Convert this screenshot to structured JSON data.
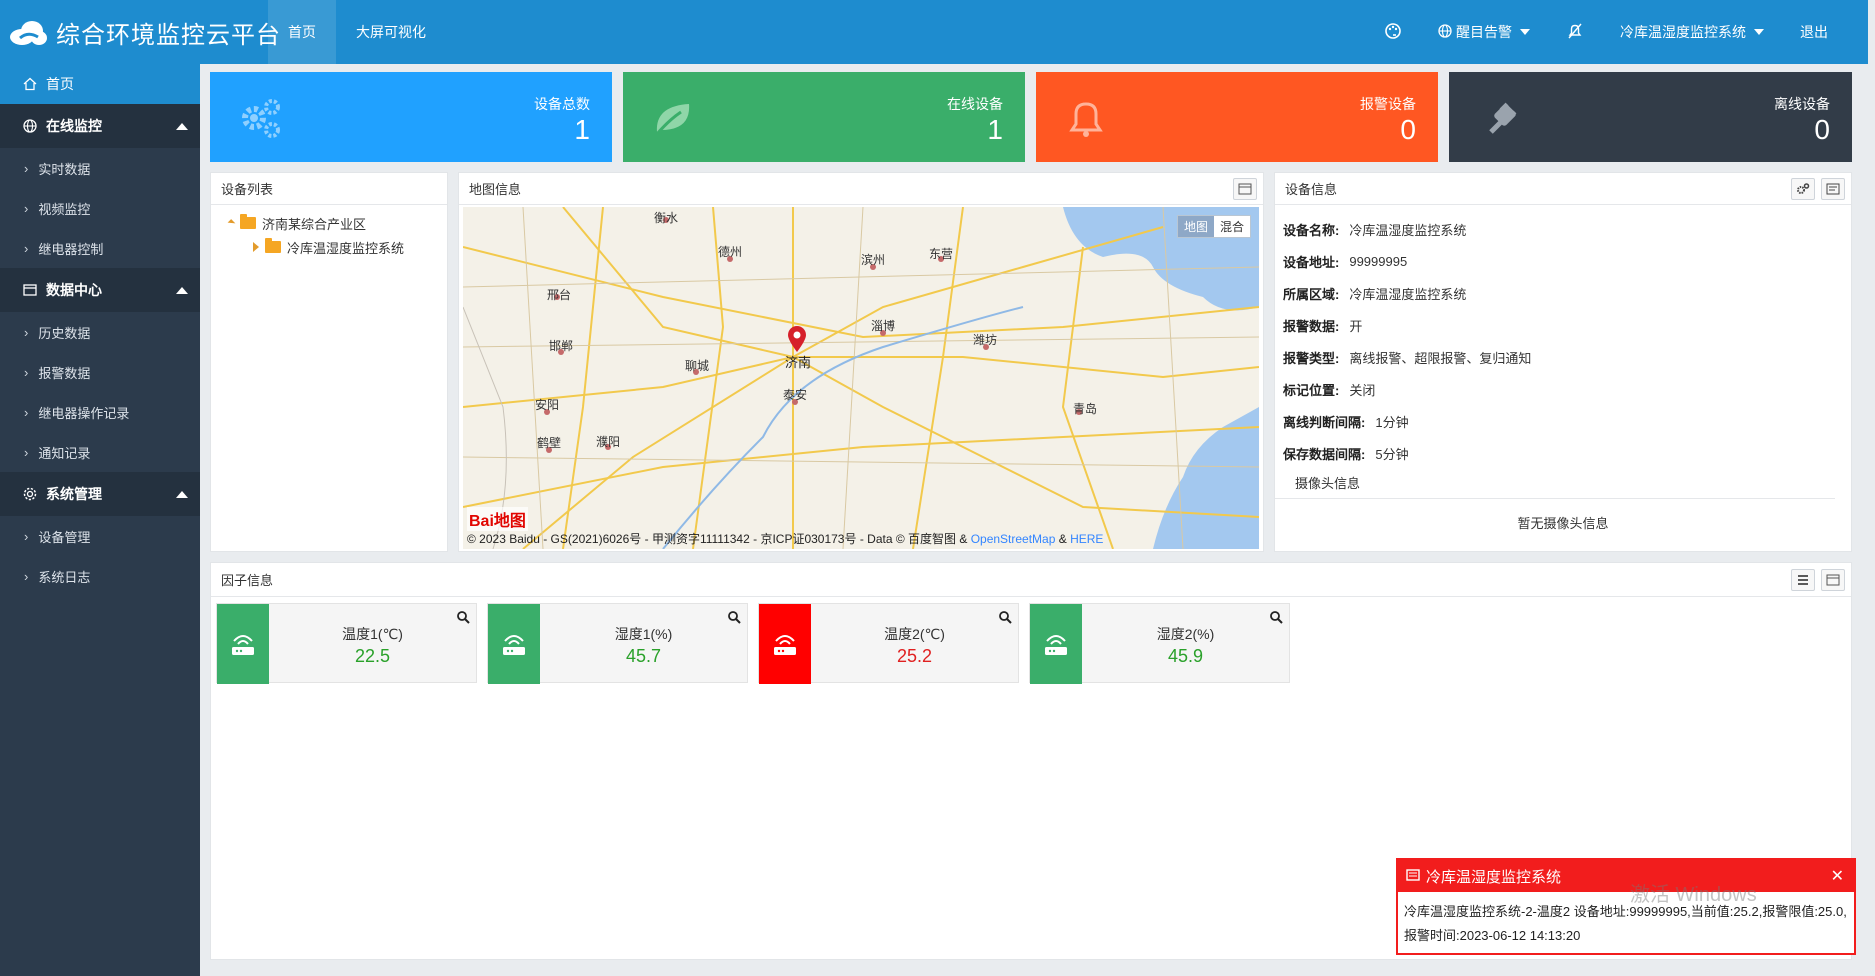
{
  "header": {
    "app_title": "综合环境监控云平台",
    "nav": [
      {
        "label": "首页",
        "active": true
      },
      {
        "label": "大屏可视化"
      }
    ],
    "right": {
      "alert_label": "醒目告警",
      "system_label": "冷库温湿度监控系统",
      "logout_label": "退出"
    }
  },
  "sidebar": {
    "home": "首页",
    "groups": [
      {
        "label": "在线监控",
        "items": [
          "实时数据",
          "视频监控",
          "继电器控制"
        ]
      },
      {
        "label": "数据中心",
        "items": [
          "历史数据",
          "报警数据",
          "继电器操作记录",
          "通知记录"
        ]
      },
      {
        "label": "系统管理",
        "items": [
          "设备管理",
          "系统日志"
        ]
      }
    ]
  },
  "stats": [
    {
      "label": "设备总数",
      "value": "1",
      "color": "#20a1ff"
    },
    {
      "label": "在线设备",
      "value": "1",
      "color": "#3aae6a"
    },
    {
      "label": "报警设备",
      "value": "0",
      "color": "#ff5722"
    },
    {
      "label": "离线设备",
      "value": "0",
      "color": "#323c48"
    }
  ],
  "device_list": {
    "title": "设备列表",
    "root": "济南某综合产业区",
    "child": "冷库温湿度监控系统"
  },
  "map_panel": {
    "title": "地图信息",
    "toggle": [
      "地图",
      "混合"
    ],
    "marker_label": "济南",
    "cities": [
      "衡水",
      "德州",
      "滨州",
      "东营",
      "邢台",
      "邯郸",
      "聊城",
      "淄博",
      "潍坊",
      "安阳",
      "泰安",
      "青岛",
      "鹤壁",
      "濮阳"
    ],
    "baidu_logo": "Bai地图",
    "copyright_prefix": "© 2023 Baidu - GS(2021)6026号 - 甲测资字11111342 - 京ICP证030173号 - Data © 百度智图 & ",
    "copyright_osm": "OpenStreetMap",
    "copyright_amp": " & ",
    "copyright_here": "HERE"
  },
  "device_info": {
    "title": "设备信息",
    "rows": [
      {
        "k": "设备名称:",
        "v": "冷库温湿度监控系统"
      },
      {
        "k": "设备地址:",
        "v": "99999995"
      },
      {
        "k": "所属区域:",
        "v": "冷库温湿度监控系统"
      },
      {
        "k": "报警数据:",
        "v": "开"
      },
      {
        "k": "报警类型:",
        "v": "离线报警、超限报警、复归通知"
      },
      {
        "k": "标记位置:",
        "v": "关闭"
      },
      {
        "k": "离线判断间隔:",
        "v": "1分钟"
      },
      {
        "k": "保存数据间隔:",
        "v": "5分钟"
      }
    ],
    "camera_title": "摄像头信息",
    "camera_empty": "暂无摄像头信息"
  },
  "factor_panel": {
    "title": "因子信息",
    "factors": [
      {
        "name": "温度1(℃)",
        "value": "22.5",
        "status_color": "#3aae6a",
        "value_color": "#2aa12a"
      },
      {
        "name": "湿度1(%)",
        "value": "45.7",
        "status_color": "#3aae6a",
        "value_color": "#2aa12a"
      },
      {
        "name": "温度2(℃)",
        "value": "25.2",
        "status_color": "#ff0000",
        "value_color": "#e02020"
      },
      {
        "name": "湿度2(%)",
        "value": "45.9",
        "status_color": "#3aae6a",
        "value_color": "#2aa12a"
      }
    ]
  },
  "alarm": {
    "title": "冷库温湿度监控系统",
    "message": "冷库温湿度监控系统-2-温度2 设备地址:99999995,当前值:25.2,报警限值:25.0,报警时间:2023-06-12 14:13:20"
  },
  "watermark": "激活 Windows"
}
